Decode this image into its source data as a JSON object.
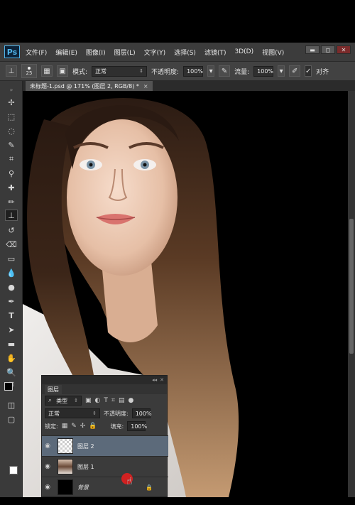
{
  "app": {
    "logo": "Ps",
    "menu": [
      "文件(F)",
      "编辑(E)",
      "图像(I)",
      "图层(L)",
      "文字(Y)",
      "选择(S)",
      "滤镜(T)",
      "3D(D)",
      "视图(V)"
    ],
    "window_controls": [
      "▬",
      "◻",
      "✕"
    ]
  },
  "options_bar": {
    "brush_size": "25",
    "mode_label": "模式:",
    "mode_value": "正常",
    "opacity_label": "不透明度:",
    "opacity_value": "100%",
    "flow_label": "流量:",
    "flow_value": "100%",
    "align_label": "对齐"
  },
  "document": {
    "tab_title": "未标题-1.psd @ 171% (图层 2, RGB/8) *",
    "close": "×"
  },
  "layers_panel": {
    "tab": "图层",
    "filter_kind": "类型",
    "blend_mode": "正常",
    "opacity_label": "不透明度:",
    "opacity_value": "100%",
    "lock_label": "锁定:",
    "fill_label": "填充:",
    "fill_value": "100%",
    "layers": [
      {
        "name": "图层 2",
        "selected": true
      },
      {
        "name": "图层 1",
        "selected": false
      },
      {
        "name": "背景",
        "selected": false
      }
    ]
  },
  "colors": {
    "menubar": "#3c3c3c",
    "selected_layer": "#5c6a7a",
    "cursor_dot": "#e21f1f"
  }
}
